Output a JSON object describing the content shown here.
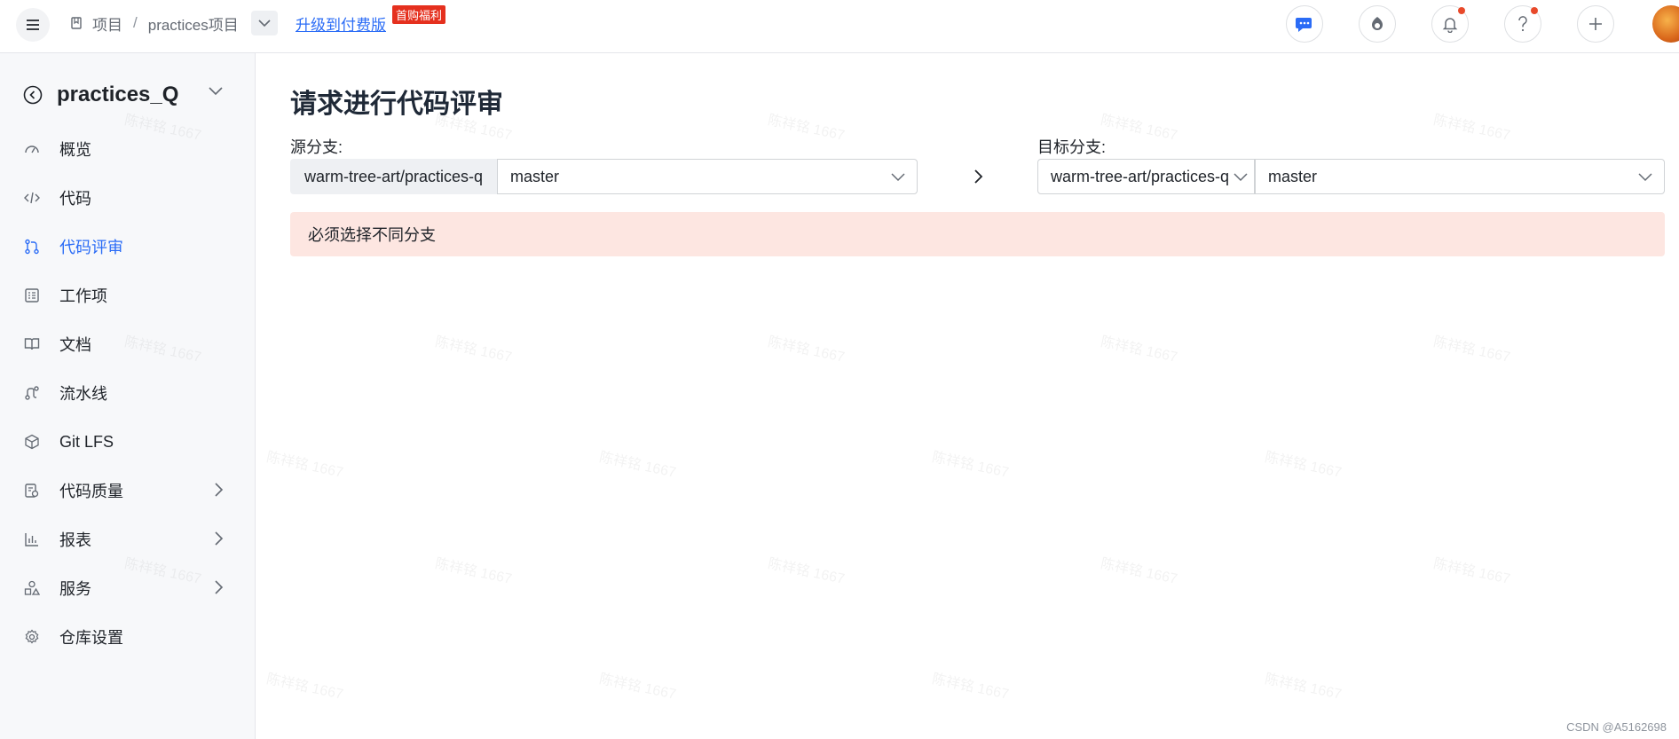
{
  "topbar": {
    "breadcrumb_root": "项目",
    "breadcrumb_sep": "/",
    "breadcrumb_project": "practices项目",
    "upgrade_link": "升级到付费版",
    "promo_badge": "首购福利",
    "icons": [
      "chat-icon",
      "copilot-icon",
      "bell-icon",
      "help-icon",
      "plus-icon"
    ]
  },
  "sidebar": {
    "project_name": "practices_Q",
    "items": [
      {
        "label": "概览",
        "icon": "dashboard-icon"
      },
      {
        "label": "代码",
        "icon": "code-icon"
      },
      {
        "label": "代码评审",
        "icon": "merge-request-icon",
        "active": true
      },
      {
        "label": "工作项",
        "icon": "work-item-icon"
      },
      {
        "label": "文档",
        "icon": "book-icon"
      },
      {
        "label": "流水线",
        "icon": "pipeline-icon"
      },
      {
        "label": "Git LFS",
        "icon": "cube-icon"
      },
      {
        "label": "代码质量",
        "icon": "quality-icon"
      },
      {
        "label": "报表",
        "icon": "chart-icon"
      },
      {
        "label": "服务",
        "icon": "shapes-icon"
      },
      {
        "label": "仓库设置",
        "icon": "gear-icon"
      }
    ]
  },
  "main": {
    "title": "请求进行代码评审",
    "source_label": "源分支:",
    "source_repo": "warm-tree-art/practices-q",
    "source_branch": "master",
    "target_label": "目标分支:",
    "target_repo": "warm-tree-art/practices-q",
    "target_branch": "master",
    "alert_text": "必须选择不同分支"
  },
  "watermark_text": "陈祥铭 1667",
  "credit": "CSDN @A5162698",
  "colors": {
    "accent": "#2b6cf6",
    "alert_bg": "#fde6e1",
    "promo": "#e5301e"
  }
}
